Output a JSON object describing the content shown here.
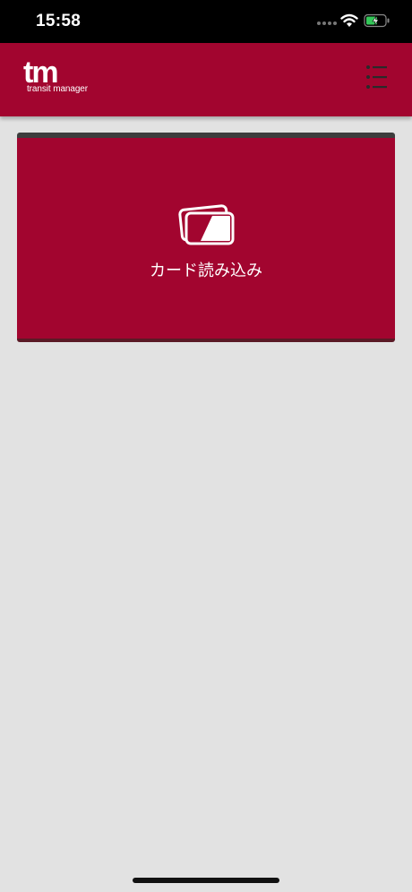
{
  "status_bar": {
    "time": "15:58",
    "icons": [
      "signal-icon",
      "wifi-icon",
      "battery-charging-icon"
    ]
  },
  "header": {
    "logo_mark": "tm",
    "logo_subtitle": "transit manager",
    "menu_icon": "list-menu-icon"
  },
  "main": {
    "card_read_label": "カード読み込み",
    "card_icon": "card-reader-icon"
  },
  "colors": {
    "brand": "#a2052f",
    "background": "#e2e2e2",
    "status_bar": "#000000",
    "battery_charge": "#34c759"
  }
}
